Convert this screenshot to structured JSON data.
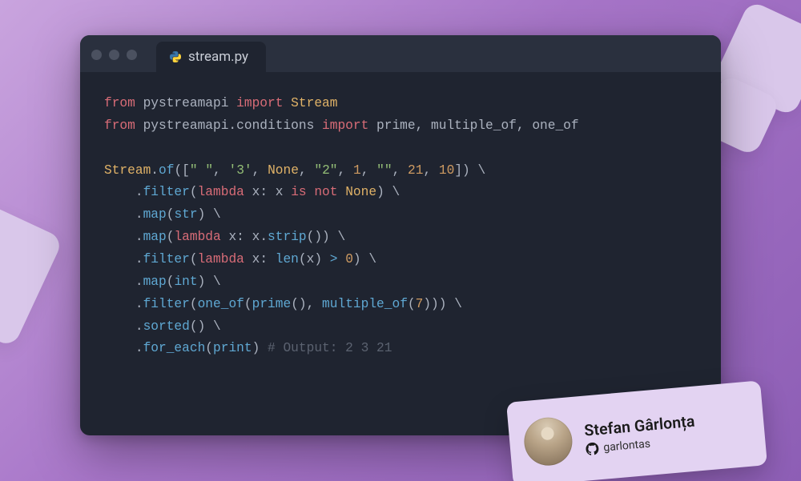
{
  "tab": {
    "filename": "stream.py"
  },
  "code": {
    "lines": [
      {
        "t": "import",
        "segs": [
          {
            "c": "kw",
            "v": "from"
          },
          {
            "c": "op",
            "v": " "
          },
          {
            "c": "mod",
            "v": "pystreamapi"
          },
          {
            "c": "op",
            "v": " "
          },
          {
            "c": "kw",
            "v": "import"
          },
          {
            "c": "op",
            "v": " "
          },
          {
            "c": "cls",
            "v": "Stream"
          }
        ]
      },
      {
        "t": "import",
        "segs": [
          {
            "c": "kw",
            "v": "from"
          },
          {
            "c": "op",
            "v": " "
          },
          {
            "c": "mod",
            "v": "pystreamapi.conditions"
          },
          {
            "c": "op",
            "v": " "
          },
          {
            "c": "kw",
            "v": "import"
          },
          {
            "c": "op",
            "v": " "
          },
          {
            "c": "mod",
            "v": "prime, multiple_of, one_of"
          }
        ]
      },
      {
        "t": "blank",
        "segs": []
      },
      {
        "t": "code",
        "segs": [
          {
            "c": "cls",
            "v": "Stream"
          },
          {
            "c": "op",
            "v": "."
          },
          {
            "c": "fn",
            "v": "of"
          },
          {
            "c": "op",
            "v": "(["
          },
          {
            "c": "str",
            "v": "\" \""
          },
          {
            "c": "op",
            "v": ", "
          },
          {
            "c": "str",
            "v": "'3'"
          },
          {
            "c": "op",
            "v": ", "
          },
          {
            "c": "cls",
            "v": "None"
          },
          {
            "c": "op",
            "v": ", "
          },
          {
            "c": "str",
            "v": "\"2\""
          },
          {
            "c": "op",
            "v": ", "
          },
          {
            "c": "num",
            "v": "1"
          },
          {
            "c": "op",
            "v": ", "
          },
          {
            "c": "str",
            "v": "\"\""
          },
          {
            "c": "op",
            "v": ", "
          },
          {
            "c": "num",
            "v": "21"
          },
          {
            "c": "op",
            "v": ", "
          },
          {
            "c": "num",
            "v": "10"
          },
          {
            "c": "op",
            "v": "]) \\"
          }
        ]
      },
      {
        "t": "code",
        "segs": [
          {
            "c": "op",
            "v": "    ."
          },
          {
            "c": "fn",
            "v": "filter"
          },
          {
            "c": "op",
            "v": "("
          },
          {
            "c": "kw",
            "v": "lambda"
          },
          {
            "c": "op",
            "v": " x: x "
          },
          {
            "c": "kw",
            "v": "is not"
          },
          {
            "c": "op",
            "v": " "
          },
          {
            "c": "cls",
            "v": "None"
          },
          {
            "c": "op",
            "v": ") \\"
          }
        ]
      },
      {
        "t": "code",
        "segs": [
          {
            "c": "op",
            "v": "    ."
          },
          {
            "c": "fn",
            "v": "map"
          },
          {
            "c": "op",
            "v": "("
          },
          {
            "c": "fn",
            "v": "str"
          },
          {
            "c": "op",
            "v": ") \\"
          }
        ]
      },
      {
        "t": "code",
        "segs": [
          {
            "c": "op",
            "v": "    ."
          },
          {
            "c": "fn",
            "v": "map"
          },
          {
            "c": "op",
            "v": "("
          },
          {
            "c": "kw",
            "v": "lambda"
          },
          {
            "c": "op",
            "v": " x: x."
          },
          {
            "c": "fn",
            "v": "strip"
          },
          {
            "c": "op",
            "v": "()) \\"
          }
        ]
      },
      {
        "t": "code",
        "segs": [
          {
            "c": "op",
            "v": "    ."
          },
          {
            "c": "fn",
            "v": "filter"
          },
          {
            "c": "op",
            "v": "("
          },
          {
            "c": "kw",
            "v": "lambda"
          },
          {
            "c": "op",
            "v": " x: "
          },
          {
            "c": "fn",
            "v": "len"
          },
          {
            "c": "op",
            "v": "(x) "
          },
          {
            "c": "cmp",
            "v": ">"
          },
          {
            "c": "op",
            "v": " "
          },
          {
            "c": "num",
            "v": "0"
          },
          {
            "c": "op",
            "v": ") \\"
          }
        ]
      },
      {
        "t": "code",
        "segs": [
          {
            "c": "op",
            "v": "    ."
          },
          {
            "c": "fn",
            "v": "map"
          },
          {
            "c": "op",
            "v": "("
          },
          {
            "c": "fn",
            "v": "int"
          },
          {
            "c": "op",
            "v": ") \\"
          }
        ]
      },
      {
        "t": "code",
        "segs": [
          {
            "c": "op",
            "v": "    ."
          },
          {
            "c": "fn",
            "v": "filter"
          },
          {
            "c": "op",
            "v": "("
          },
          {
            "c": "fn",
            "v": "one_of"
          },
          {
            "c": "op",
            "v": "("
          },
          {
            "c": "fn",
            "v": "prime"
          },
          {
            "c": "op",
            "v": "(), "
          },
          {
            "c": "fn",
            "v": "multiple_of"
          },
          {
            "c": "op",
            "v": "("
          },
          {
            "c": "num",
            "v": "7"
          },
          {
            "c": "op",
            "v": "))) \\"
          }
        ]
      },
      {
        "t": "code",
        "segs": [
          {
            "c": "op",
            "v": "    ."
          },
          {
            "c": "fn",
            "v": "sorted"
          },
          {
            "c": "op",
            "v": "() \\"
          }
        ]
      },
      {
        "t": "code",
        "segs": [
          {
            "c": "op",
            "v": "    ."
          },
          {
            "c": "fn",
            "v": "for_each"
          },
          {
            "c": "op",
            "v": "("
          },
          {
            "c": "fn",
            "v": "print"
          },
          {
            "c": "op",
            "v": ") "
          },
          {
            "c": "cmt",
            "v": "# Output: 2 3 21"
          }
        ]
      }
    ]
  },
  "author": {
    "name": "Stefan Gârlonța",
    "handle": "garlontas"
  }
}
